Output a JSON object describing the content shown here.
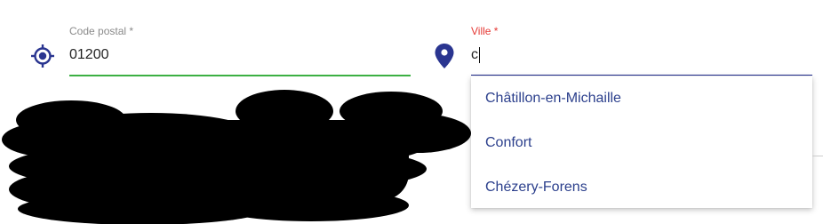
{
  "postal_field": {
    "label": "Code postal *",
    "value": "01200",
    "icon": "location-target-icon",
    "underline_color": "#3cb043"
  },
  "city_field": {
    "label": "Ville *",
    "value": "c",
    "icon": "map-pin-icon",
    "label_color": "#e53935",
    "underline_color": "#1e2a8c"
  },
  "suggestions": [
    {
      "label": "Châtillon-en-Michaille"
    },
    {
      "label": "Confort"
    },
    {
      "label": "Chézery-Forens"
    }
  ],
  "colors": {
    "accent": "#2b3f8c",
    "icon": "#2a3590"
  }
}
